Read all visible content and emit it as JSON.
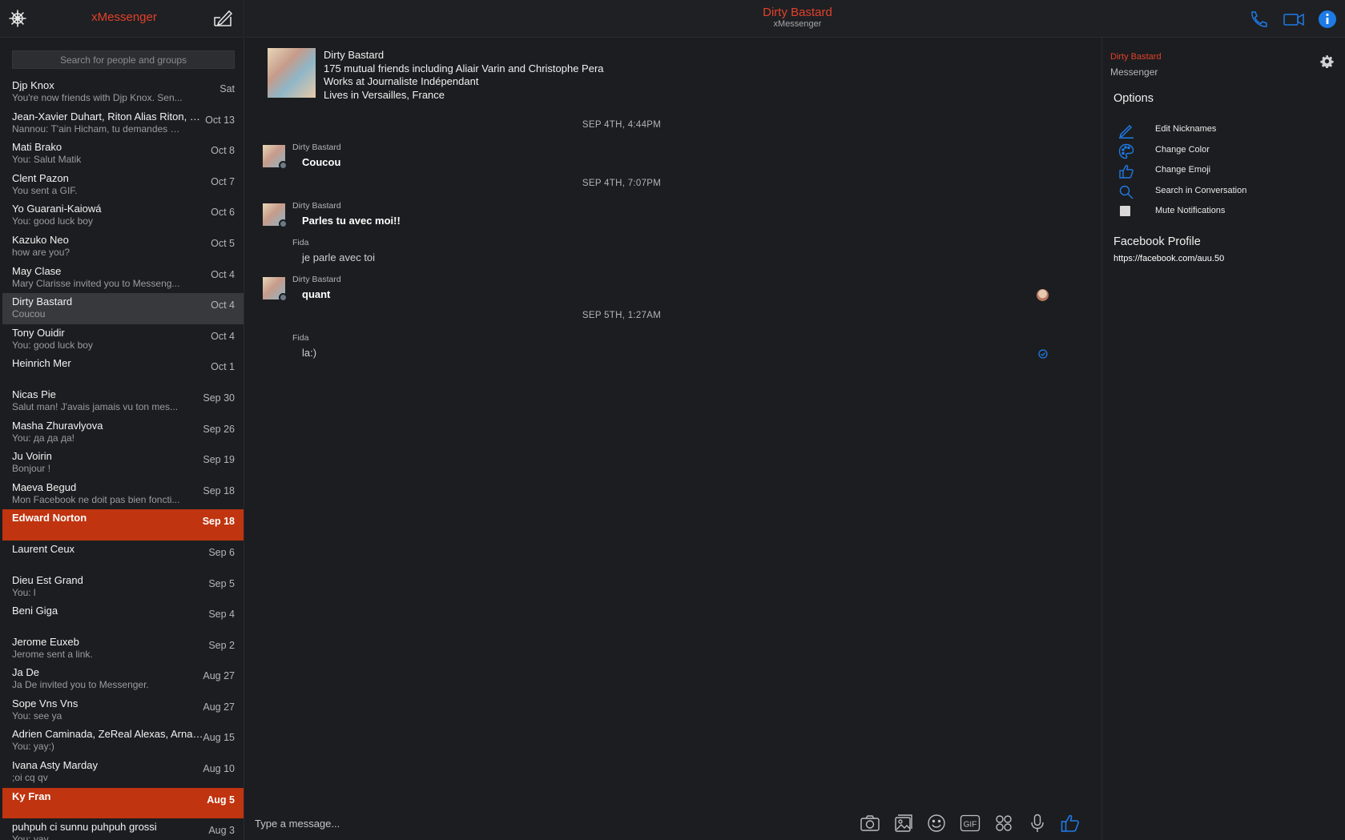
{
  "app": {
    "title": "xMessenger"
  },
  "search": {
    "placeholder": "Search for people and groups"
  },
  "conversations": [
    {
      "name": "Djp Knox",
      "preview": "You're now friends with Djp Knox. Sen...",
      "date": "Sat"
    },
    {
      "name": "Jean-Xavier Duhart, Riton Alias Riton, S...",
      "preview": "Nannou: T'ain Hicham, tu demandes d...",
      "date": "Oct 13"
    },
    {
      "name": "Mati Brako",
      "preview": "You: Salut Matik",
      "date": "Oct 8"
    },
    {
      "name": "Clent Pazon",
      "preview": "You sent a GIF.",
      "date": "Oct 7"
    },
    {
      "name": "Yo Guarani-Kaiowá",
      "preview": "You: good luck boy",
      "date": "Oct 6"
    },
    {
      "name": "Kazuko Neo",
      "preview": "how are you?",
      "date": "Oct 5"
    },
    {
      "name": "May Clase",
      "preview": "Mary Clarisse invited you to Messeng...",
      "date": "Oct 4"
    },
    {
      "name": "Dirty Bastard",
      "preview": "Coucou",
      "date": "Oct 4"
    },
    {
      "name": "Tony Ouidir",
      "preview": "You: good luck boy",
      "date": "Oct 4"
    },
    {
      "name": "Heinrich Mer",
      "preview": "",
      "date": "Oct 1"
    },
    {
      "name": "Nicas Pie",
      "preview": "Salut man! J'avais jamais vu ton mes...",
      "date": "Sep 30"
    },
    {
      "name": "Masha Zhuravlyova",
      "preview": "You: да да да!",
      "date": "Sep 26"
    },
    {
      "name": "Ju Voirin",
      "preview": "Bonjour !",
      "date": "Sep 19"
    },
    {
      "name": "Maeva Begud",
      "preview": "Mon Facebook ne doit pas bien foncti...",
      "date": "Sep 18"
    },
    {
      "name": "Edward Norton",
      "preview": "",
      "date": "Sep 18"
    },
    {
      "name": "Laurent Ceux",
      "preview": "",
      "date": "Sep 6"
    },
    {
      "name": "Dieu Est Grand",
      "preview": "You: l",
      "date": "Sep 5"
    },
    {
      "name": "Beni Giga",
      "preview": "",
      "date": "Sep 4"
    },
    {
      "name": "Jerome Euxeb",
      "preview": "Jerome sent a link.",
      "date": "Sep 2"
    },
    {
      "name": "Ja De",
      "preview": "Ja De invited you to Messenger.",
      "date": "Aug 27"
    },
    {
      "name": "Sope Vns Vns",
      "preview": "You: see ya",
      "date": "Aug 27"
    },
    {
      "name": "Adrien Caminada, ZeReal Alexas, Arnau...",
      "preview": "You: yay:)",
      "date": "Aug 15"
    },
    {
      "name": "Ivana Asty Marday",
      "preview": ";oi cq qv",
      "date": "Aug 10"
    },
    {
      "name": "Ky Fran",
      "preview": "",
      "date": "Aug 5"
    },
    {
      "name": "puhpuh ci sunnu puhpuh grossi",
      "preview": "You: yay",
      "date": "Aug 3"
    }
  ],
  "header": {
    "title": "Dirty Bastard",
    "subtitle": "xMessenger"
  },
  "profile": {
    "name": "Dirty Bastard",
    "mutual": "175 mutual friends including Aliair Varin and Christophe Pera",
    "work": "Works at Journaliste Indépendant",
    "lives": "Lives in Versailles, France"
  },
  "messages": {
    "sep1": "SEP 4TH, 4:44PM",
    "m1_sender": "Dirty Bastard",
    "m1_text": "Coucou",
    "sep2": "SEP 4TH, 7:07PM",
    "m2_sender": "Dirty Bastard",
    "m2_text": "Parles tu avec moi!!",
    "m3_sender": "Fida",
    "m3_text": "je parle avec toi",
    "m4_sender": "Dirty Bastard",
    "m4_text": "quant",
    "sep3": "SEP 5TH, 1:27AM",
    "m5_sender": "Fida",
    "m5_text": "la:)"
  },
  "composer": {
    "placeholder": "Type a message..."
  },
  "right_panel": {
    "name": "Dirty Bastard",
    "subtitle": "Messenger",
    "options_title": "Options",
    "options": [
      {
        "label": "Edit Nicknames",
        "icon": "pencil-icon"
      },
      {
        "label": "Change Color",
        "icon": "palette-icon"
      },
      {
        "label": "Change Emoji",
        "icon": "thumbs-up-icon"
      },
      {
        "label": "Search in Conversation",
        "icon": "search-icon"
      },
      {
        "label": "Mute Notifications",
        "icon": "checkbox"
      }
    ],
    "fb_profile_title": "Facebook Profile",
    "fb_profile_link": "https://facebook.com/auu.50"
  },
  "colors": {
    "accent": "#e2412b",
    "unread": "#c03410",
    "selected": "#38393d",
    "icon_blue": "#1e7be6",
    "background": "#1c1d20"
  }
}
